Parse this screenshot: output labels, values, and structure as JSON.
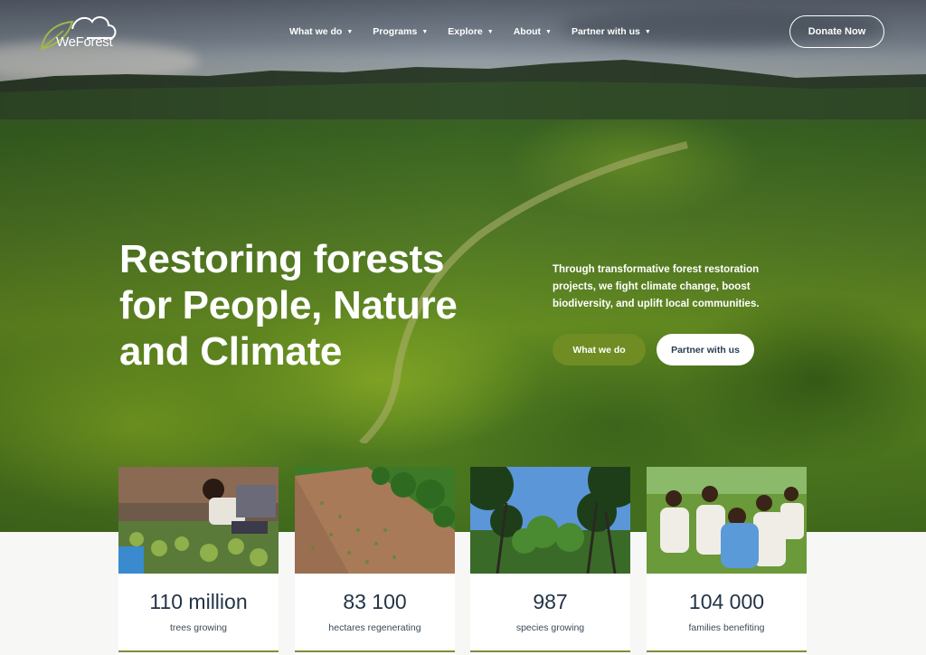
{
  "brand": {
    "name": "WeForest"
  },
  "nav": {
    "items": [
      {
        "label": "What we do"
      },
      {
        "label": "Programs"
      },
      {
        "label": "Explore"
      },
      {
        "label": "About"
      },
      {
        "label": "Partner with us"
      }
    ],
    "donate_label": "Donate Now"
  },
  "hero": {
    "headline_lines": [
      "Restoring forests",
      "for People, Nature",
      "and Climate"
    ],
    "subtext": "Through transformative forest restoration projects, we fight climate change, boost biodiversity, and uplift local communities.",
    "primary_cta": "What we do",
    "secondary_cta": "Partner with us"
  },
  "stats": [
    {
      "value": "110 million",
      "label": "trees growing",
      "image": "tree-nursery-photo"
    },
    {
      "value": "83 100",
      "label": "hectares regenerating",
      "image": "aerial-planting-photo"
    },
    {
      "value": "987",
      "label": "species growing",
      "image": "forest-canopy-photo"
    },
    {
      "value": "104 000",
      "label": "families benefiting",
      "image": "community-women-photo"
    }
  ],
  "colors": {
    "accent_green": "#6f8d23",
    "heading_navy": "#243447",
    "white": "#ffffff"
  }
}
